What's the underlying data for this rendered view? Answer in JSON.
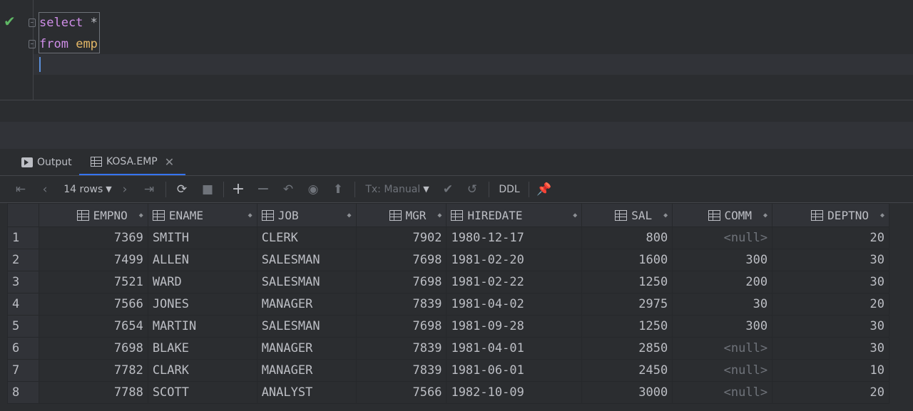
{
  "editor": {
    "line1_kw": "select",
    "line1_rest": " *",
    "line2_kw": "from",
    "line2_ident": "emp"
  },
  "tabs": {
    "output_label": "Output",
    "table_label": "KOSA.EMP"
  },
  "toolbar": {
    "rows_label": "14 rows",
    "tx_label": "Tx: Manual",
    "ddl_label": "DDL"
  },
  "grid": {
    "columns": [
      "EMPNO",
      "ENAME",
      "JOB",
      "MGR",
      "HIREDATE",
      "SAL",
      "COMM",
      "DEPTNO"
    ],
    "rows": [
      [
        "1",
        "7369",
        "SMITH",
        "CLERK",
        "7902",
        "1980-12-17",
        "800",
        "<null>",
        "20"
      ],
      [
        "2",
        "7499",
        "ALLEN",
        "SALESMAN",
        "7698",
        "1981-02-20",
        "1600",
        "300",
        "30"
      ],
      [
        "3",
        "7521",
        "WARD",
        "SALESMAN",
        "7698",
        "1981-02-22",
        "1250",
        "200",
        "30"
      ],
      [
        "4",
        "7566",
        "JONES",
        "MANAGER",
        "7839",
        "1981-04-02",
        "2975",
        "30",
        "20"
      ],
      [
        "5",
        "7654",
        "MARTIN",
        "SALESMAN",
        "7698",
        "1981-09-28",
        "1250",
        "300",
        "30"
      ],
      [
        "6",
        "7698",
        "BLAKE",
        "MANAGER",
        "7839",
        "1981-04-01",
        "2850",
        "<null>",
        "30"
      ],
      [
        "7",
        "7782",
        "CLARK",
        "MANAGER",
        "7839",
        "1981-06-01",
        "2450",
        "<null>",
        "10"
      ],
      [
        "8",
        "7788",
        "SCOTT",
        "ANALYST",
        "7566",
        "1982-10-09",
        "3000",
        "<null>",
        "20"
      ]
    ]
  },
  "colors": {
    "keyword": "#cf8ee8",
    "identifier": "#e5b867",
    "accent": "#3574f0",
    "success": "#5fb865"
  }
}
